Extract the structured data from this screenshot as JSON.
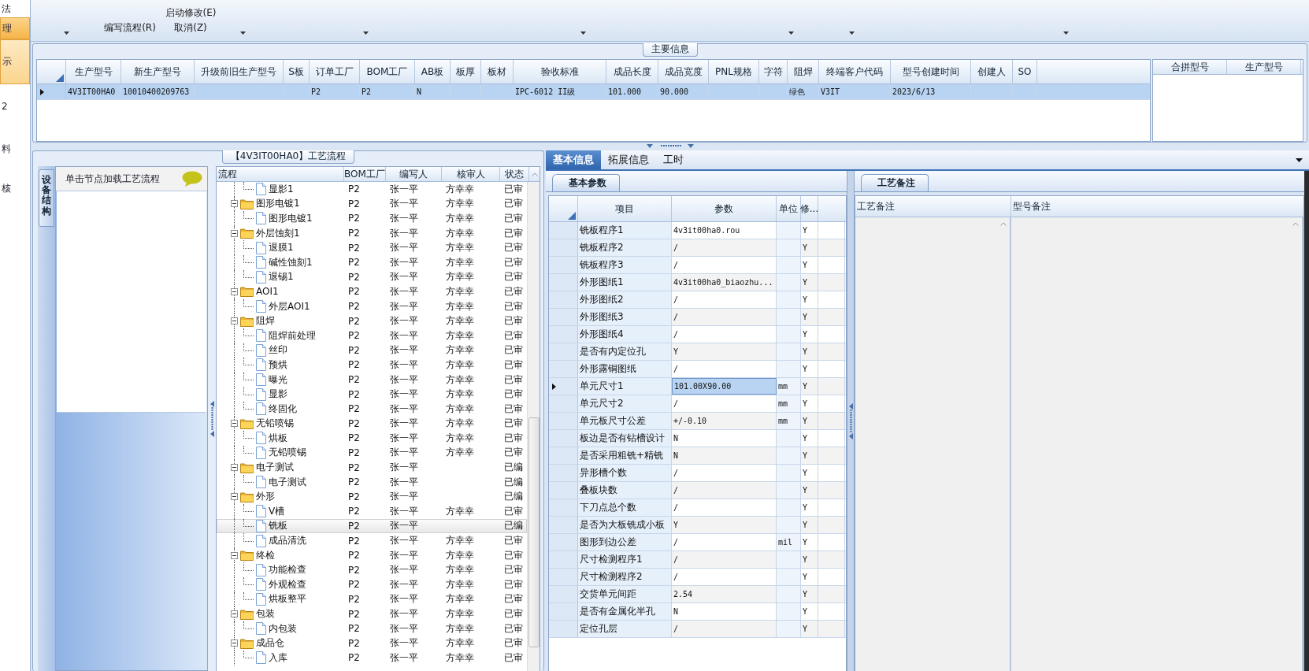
{
  "sidebar": {
    "items": [
      {
        "label": "法",
        "selected": false
      },
      {
        "label": "理",
        "selected": true
      },
      {
        "label": "示",
        "selected": true
      },
      {
        "label": "2",
        "selected": false
      },
      {
        "label": "料",
        "selected": false
      },
      {
        "label": "核",
        "selected": false
      }
    ]
  },
  "toolbar": {
    "groups": [
      {
        "dropdown": true
      },
      {
        "labels": [
          "编写流程(R)"
        ]
      },
      {
        "labels": [
          "启动修改(E)",
          "取消(Z)"
        ]
      },
      {
        "dropdown": true
      },
      {
        "dropdown": true
      },
      {
        "dropdown": true
      },
      {
        "dropdown": true
      },
      {
        "dropdown": true
      },
      {
        "dropdown": true
      }
    ]
  },
  "main_info": {
    "title": "主要信息",
    "columns": [
      "生产型号",
      "新生产型号",
      "升级前旧生产型号",
      "S板",
      "订单工厂",
      "BOM工厂",
      "AB板",
      "板厚",
      "板材",
      "验收标准",
      "成品长度",
      "成品宽度",
      "PNL规格",
      "字符",
      "阻焊",
      "终端客户代码",
      "型号创建时间",
      "创建人",
      "SO"
    ],
    "rows": [
      {
        "selected": true,
        "cells": [
          "4V3IT00HA0",
          "10010400209763",
          null,
          null,
          "P2",
          "P2",
          "N",
          null,
          null,
          "IPC-6012 II级",
          "101.000",
          "90.000",
          null,
          null,
          "绿色",
          "V3IT",
          "2023/6/13",
          null,
          null
        ]
      }
    ],
    "merge_table": {
      "columns": [
        "合拼型号",
        "生产型号"
      ]
    }
  },
  "process_flow": {
    "title": "【4V3IT00HA0】工艺流程",
    "side_tab": "设备结构",
    "structure_panel": {
      "title": "单击节点加载工艺流程"
    },
    "columns": [
      "流程",
      "BOM工厂",
      "编写人",
      "核审人",
      "状态"
    ],
    "leading_children": [
      {
        "name": "显影1",
        "bom": "P2",
        "writer": "张一平",
        "reviewer": "方幸幸",
        "status": "已审",
        "selected": false
      }
    ],
    "nodes": [
      {
        "name": "图形电镀1",
        "bom": "P2",
        "writer": "张一平",
        "reviewer": "方幸幸",
        "status": "已审",
        "selected": false,
        "expanded": true,
        "children": [
          {
            "name": "图形电镀1",
            "bom": "P2",
            "writer": "张一平",
            "reviewer": "方幸幸",
            "status": "已审",
            "selected": false
          }
        ]
      },
      {
        "name": "外层蚀刻1",
        "bom": "P2",
        "writer": "张一平",
        "reviewer": "方幸幸",
        "status": "已审",
        "selected": false,
        "expanded": true,
        "children": [
          {
            "name": "退膜1",
            "bom": "P2",
            "writer": "张一平",
            "reviewer": "方幸幸",
            "status": "已审",
            "selected": false
          },
          {
            "name": "碱性蚀刻1",
            "bom": "P2",
            "writer": "张一平",
            "reviewer": "方幸幸",
            "status": "已审",
            "selected": false
          },
          {
            "name": "退锡1",
            "bom": "P2",
            "writer": "张一平",
            "reviewer": "方幸幸",
            "status": "已审",
            "selected": false
          }
        ]
      },
      {
        "name": "AOI1",
        "bom": "P2",
        "writer": "张一平",
        "reviewer": "方幸幸",
        "status": "已审",
        "selected": false,
        "expanded": true,
        "children": [
          {
            "name": "外层AOI1",
            "bom": "P2",
            "writer": "张一平",
            "reviewer": "方幸幸",
            "status": "已审",
            "selected": false
          }
        ]
      },
      {
        "name": "阻焊",
        "bom": "P2",
        "writer": "张一平",
        "reviewer": "方幸幸",
        "status": "已审",
        "selected": false,
        "expanded": true,
        "children": [
          {
            "name": "阻焊前处理",
            "bom": "P2",
            "writer": "张一平",
            "reviewer": "方幸幸",
            "status": "已审",
            "selected": false
          },
          {
            "name": "丝印",
            "bom": "P2",
            "writer": "张一平",
            "reviewer": "方幸幸",
            "status": "已审",
            "selected": false
          },
          {
            "name": "预烘",
            "bom": "P2",
            "writer": "张一平",
            "reviewer": "方幸幸",
            "status": "已审",
            "selected": false
          },
          {
            "name": "曝光",
            "bom": "P2",
            "writer": "张一平",
            "reviewer": "方幸幸",
            "status": "已审",
            "selected": false
          },
          {
            "name": "显影",
            "bom": "P2",
            "writer": "张一平",
            "reviewer": "方幸幸",
            "status": "已审",
            "selected": false
          },
          {
            "name": "终固化",
            "bom": "P2",
            "writer": "张一平",
            "reviewer": "方幸幸",
            "status": "已审",
            "selected": false
          }
        ]
      },
      {
        "name": "无铅喷锡",
        "bom": "P2",
        "writer": "张一平",
        "reviewer": "方幸幸",
        "status": "已审",
        "selected": false,
        "expanded": true,
        "children": [
          {
            "name": "烘板",
            "bom": "P2",
            "writer": "张一平",
            "reviewer": "方幸幸",
            "status": "已审",
            "selected": false
          },
          {
            "name": "无铅喷锡",
            "bom": "P2",
            "writer": "张一平",
            "reviewer": "方幸幸",
            "status": "已审",
            "selected": false
          }
        ]
      },
      {
        "name": "电子测试",
        "bom": "P2",
        "writer": "张一平",
        "status": "已编",
        "selected": false,
        "expanded": true,
        "children": [
          {
            "name": "电子测试",
            "bom": "P2",
            "writer": "张一平",
            "status": "已编",
            "selected": false
          }
        ]
      },
      {
        "name": "外形",
        "bom": "P2",
        "writer": "张一平",
        "status": "已编",
        "selected": false,
        "expanded": true,
        "children": [
          {
            "name": "V槽",
            "bom": "P2",
            "writer": "张一平",
            "reviewer": "方幸幸",
            "status": "已审",
            "selected": false
          },
          {
            "name": "铣板",
            "bom": "P2",
            "writer": "张一平",
            "status": "已编",
            "selected": true
          },
          {
            "name": "成品清洗",
            "bom": "P2",
            "writer": "张一平",
            "reviewer": "方幸幸",
            "status": "已审",
            "selected": false
          }
        ]
      },
      {
        "name": "终检",
        "bom": "P2",
        "writer": "张一平",
        "reviewer": "方幸幸",
        "status": "已审",
        "selected": false,
        "expanded": true,
        "children": [
          {
            "name": "功能检查",
            "bom": "P2",
            "writer": "张一平",
            "reviewer": "方幸幸",
            "status": "已审",
            "selected": false
          },
          {
            "name": "外观检查",
            "bom": "P2",
            "writer": "张一平",
            "reviewer": "方幸幸",
            "status": "已审",
            "selected": false
          },
          {
            "name": "烘板整平",
            "bom": "P2",
            "writer": "张一平",
            "reviewer": "方幸幸",
            "status": "已审",
            "selected": false
          }
        ]
      },
      {
        "name": "包装",
        "bom": "P2",
        "writer": "张一平",
        "reviewer": "方幸幸",
        "status": "已审",
        "selected": false,
        "expanded": true,
        "children": [
          {
            "name": "内包装",
            "bom": "P2",
            "writer": "张一平",
            "reviewer": "方幸幸",
            "status": "已审",
            "selected": false
          }
        ]
      },
      {
        "name": "成品仓",
        "bom": "P2",
        "writer": "张一平",
        "reviewer": "方幸幸",
        "status": "已审",
        "selected": false,
        "expanded": true,
        "children": [
          {
            "name": "入库",
            "bom": "P2",
            "writer": "张一平",
            "reviewer": "方幸幸",
            "status": "已审",
            "selected": false
          }
        ]
      }
    ]
  },
  "detail": {
    "tabs": [
      {
        "label": "基本信息",
        "selected": true
      },
      {
        "label": "拓展信息",
        "selected": false
      },
      {
        "label": "工时",
        "selected": false
      }
    ],
    "basic_params": {
      "tab": "基本参数",
      "columns": [
        "项目",
        "参数",
        "单位",
        "修..."
      ],
      "rows": [
        {
          "item": "铣板程序1",
          "value": "4v3it00ha0.rou",
          "modified": "Y",
          "selected": false
        },
        {
          "item": "铣板程序2",
          "value": "/",
          "modified": "Y",
          "selected": false
        },
        {
          "item": "铣板程序3",
          "value": "/",
          "modified": "Y",
          "selected": false
        },
        {
          "item": "外形图纸1",
          "value": "4v3it00ha0_biaozhu...",
          "modified": "Y",
          "selected": false
        },
        {
          "item": "外形图纸2",
          "value": "/",
          "modified": "Y",
          "selected": false
        },
        {
          "item": "外形图纸3",
          "value": "/",
          "modified": "Y",
          "selected": false
        },
        {
          "item": "外形图纸4",
          "value": "/",
          "modified": "Y",
          "selected": false
        },
        {
          "item": "是否有内定位孔",
          "value": "Y",
          "modified": "Y",
          "selected": false
        },
        {
          "item": "外形露铜图纸",
          "value": "/",
          "modified": "Y",
          "selected": false
        },
        {
          "item": "单元尺寸1",
          "value": "101.00X90.00",
          "unit": "mm",
          "modified": "Y",
          "selected": true
        },
        {
          "item": "单元尺寸2",
          "value": "/",
          "unit": "mm",
          "modified": "Y",
          "selected": false
        },
        {
          "item": "单元板尺寸公差",
          "value": "+/-0.10",
          "unit": "mm",
          "modified": "Y",
          "selected": false
        },
        {
          "item": "板边是否有钻槽设计",
          "value": "N",
          "modified": "Y",
          "selected": false
        },
        {
          "item": "是否采用粗铣+精铣",
          "value": "N",
          "modified": "Y",
          "selected": false
        },
        {
          "item": "异形槽个数",
          "value": "/",
          "modified": "Y",
          "selected": false
        },
        {
          "item": "叠板块数",
          "value": "/",
          "modified": "Y",
          "selected": false
        },
        {
          "item": "下刀点总个数",
          "value": "/",
          "modified": "Y",
          "selected": false
        },
        {
          "item": "是否为大板铣成小板",
          "value": "Y",
          "modified": "Y",
          "selected": false
        },
        {
          "item": "图形到边公差",
          "value": "/",
          "unit": "mil",
          "modified": "Y",
          "selected": false
        },
        {
          "item": "尺寸检测程序1",
          "value": "/",
          "modified": "Y",
          "selected": false
        },
        {
          "item": "尺寸检测程序2",
          "value": "/",
          "modified": "Y",
          "selected": false
        },
        {
          "item": "交货单元间距",
          "value": "2.54",
          "modified": "Y",
          "selected": false
        },
        {
          "item": "是否有金属化半孔",
          "value": "N",
          "modified": "Y",
          "selected": false
        },
        {
          "item": "定位孔层",
          "value": "/",
          "modified": "Y",
          "selected": false
        }
      ]
    },
    "remarks": {
      "tab": "工艺备注",
      "columns": [
        "工艺备注",
        "型号备注"
      ]
    }
  }
}
